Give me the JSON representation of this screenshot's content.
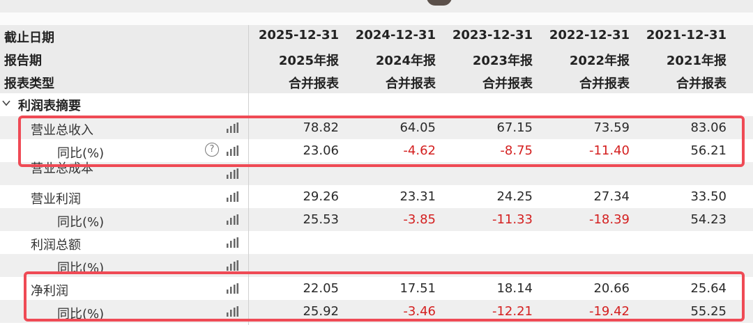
{
  "header": {
    "rows": [
      {
        "label": "截止日期",
        "values": [
          "2025-12-31",
          "2024-12-31",
          "2023-12-31",
          "2022-12-31",
          "2021-12-31"
        ]
      },
      {
        "label": "报告期",
        "values": [
          "2025年报",
          "2024年报",
          "2023年报",
          "2022年报",
          "2021年报"
        ]
      },
      {
        "label": "报表类型",
        "values": [
          "合并报表",
          "合并报表",
          "合并报表",
          "合并报表",
          "合并报表"
        ]
      }
    ]
  },
  "section": {
    "label": "利润表摘要",
    "icon": "chevron-down-icon"
  },
  "rows": [
    {
      "label": "营业总收入",
      "level": 1,
      "help": false,
      "values": [
        "78.82",
        "64.05",
        "67.15",
        "73.59",
        "83.06"
      ]
    },
    {
      "label": "同比(%)",
      "level": 2,
      "help": true,
      "values": [
        "23.06",
        "-4.62",
        "-8.75",
        "-11.40",
        "56.21"
      ]
    },
    {
      "label": "营业总成本",
      "level": 1,
      "help": false,
      "values": [
        "",
        "",
        "",
        "",
        ""
      ]
    },
    {
      "label": "营业利润",
      "level": 1,
      "help": false,
      "values": [
        "29.26",
        "23.31",
        "24.25",
        "27.34",
        "33.50"
      ]
    },
    {
      "label": "同比(%)",
      "level": 2,
      "help": false,
      "values": [
        "25.53",
        "-3.85",
        "-11.33",
        "-18.39",
        "54.23"
      ]
    },
    {
      "label": "利润总额",
      "level": 1,
      "help": false,
      "values": [
        "",
        "",
        "",
        "",
        ""
      ]
    },
    {
      "label": "同比(%)",
      "level": 2,
      "help": false,
      "values": [
        "",
        "",
        "",
        "",
        ""
      ]
    },
    {
      "label": "净利润",
      "level": 1,
      "help": false,
      "values": [
        "22.05",
        "17.51",
        "18.14",
        "20.66",
        "25.64"
      ]
    },
    {
      "label": "同比(%)",
      "level": 2,
      "help": false,
      "values": [
        "25.92",
        "-3.46",
        "-12.21",
        "-19.42",
        "55.25"
      ]
    }
  ],
  "icons": {
    "chart": "bar-chart-icon",
    "help": "question-mark-icon"
  },
  "colors": {
    "negative": "#d42020",
    "highlight": "#ef4a55",
    "header_bg": "#ebebeb",
    "alt_row_bg": "#efefef"
  },
  "help_glyph": "?"
}
